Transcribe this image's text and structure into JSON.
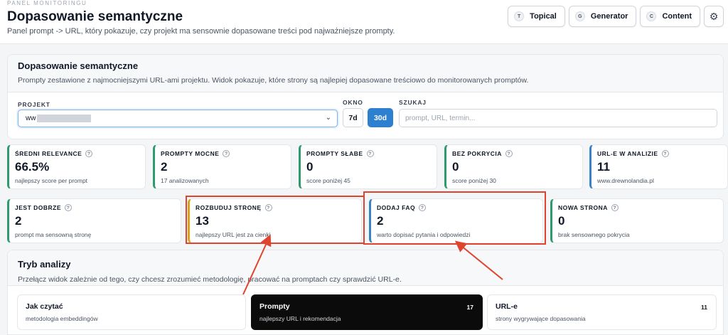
{
  "header": {
    "eyebrow": "PANEL MONITORINGU",
    "title": "Dopasowanie semantyczne",
    "subtitle": "Panel prompt -> URL, który pokazuje, czy projekt ma sensownie dopasowane treści pod najważniejsze prompty."
  },
  "nav": [
    {
      "badge": "T",
      "label": "Topical"
    },
    {
      "badge": "G",
      "label": "Generator"
    },
    {
      "badge": "C",
      "label": "Content"
    }
  ],
  "filters": {
    "title": "Dopasowanie semantyczne",
    "description": "Prompty zestawione z najmocniejszymi URL-ami projektu. Widok pokazuje, które strony są najlepiej dopasowane treściowo do monitorowanych promptów.",
    "project_label": "PROJEKT",
    "project_value": "ww",
    "window_label": "OKNO",
    "window_options": [
      "7d",
      "30d"
    ],
    "search_label": "SZUKAJ",
    "search_placeholder": "prompt, URL, termin..."
  },
  "stats_row1": [
    {
      "title": "ŚREDNI RELEVANCE",
      "value": "66.5%",
      "sub": "najlepszy score per prompt"
    },
    {
      "title": "PROMPTY MOCNE",
      "value": "2",
      "sub": "17 analizowanych"
    },
    {
      "title": "PROMPTY SŁABE",
      "value": "0",
      "sub": "score poniżej 45"
    },
    {
      "title": "BEZ POKRYCIA",
      "value": "0",
      "sub": "score poniżej 30"
    },
    {
      "title": "URL-E W ANALIZIE",
      "value": "11",
      "sub": "www.drewnolandia.pl"
    }
  ],
  "stats_row2": [
    {
      "title": "JEST DOBRZE",
      "value": "2",
      "sub": "prompt ma sensowną stronę"
    },
    {
      "title": "ROZBUDUJ STRONĘ",
      "value": "13",
      "sub": "najlepszy URL jest za cienki"
    },
    {
      "title": "DODAJ FAQ",
      "value": "2",
      "sub": "warto dopisać pytania i odpowiedzi"
    },
    {
      "title": "NOWA STRONA",
      "value": "0",
      "sub": "brak sensownego pokrycia"
    }
  ],
  "analysis": {
    "title": "Tryb analizy",
    "description": "Przełącz widok zależnie od tego, czy chcesz zrozumieć metodologię, pracować na promptach czy sprawdzić URL-e.",
    "modes": [
      {
        "title": "Jak czytać",
        "sub": "metodologia embeddingów",
        "count": ""
      },
      {
        "title": "Prompty",
        "sub": "najlepszy URL i rekomendacja",
        "count": "17"
      },
      {
        "title": "URL-e",
        "sub": "strony wygrywające dopasowania",
        "count": "11"
      }
    ]
  },
  "colors": {
    "accent_blue": "#2d7fd0",
    "stat_green": "#2f9a6e",
    "stat_blue": "#3b82c4",
    "stat_amber": "#d9a21a",
    "annotation_red": "#e0442e"
  },
  "icons": {
    "settings": "gear-icon",
    "select": "chevron-down-icon",
    "help": "question-icon"
  }
}
